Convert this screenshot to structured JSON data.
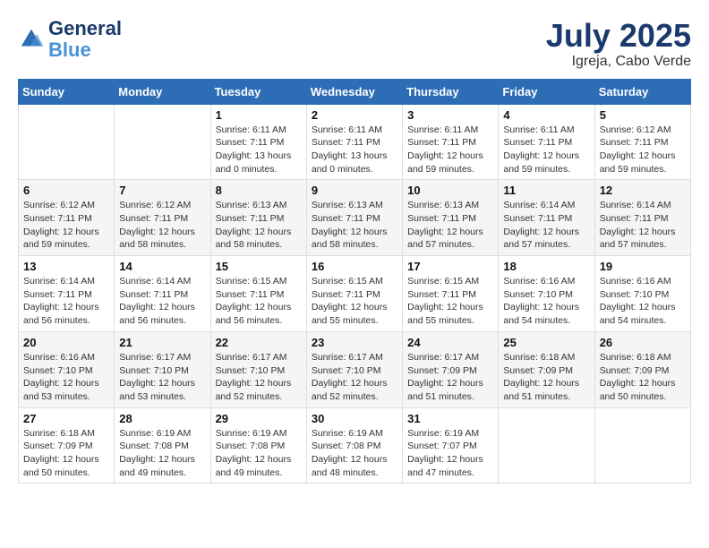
{
  "header": {
    "logo_line1": "General",
    "logo_line2": "Blue",
    "month": "July 2025",
    "location": "Igreja, Cabo Verde"
  },
  "days_of_week": [
    "Sunday",
    "Monday",
    "Tuesday",
    "Wednesday",
    "Thursday",
    "Friday",
    "Saturday"
  ],
  "weeks": [
    [
      {
        "day": "",
        "info": ""
      },
      {
        "day": "",
        "info": ""
      },
      {
        "day": "1",
        "info": "Sunrise: 6:11 AM\nSunset: 7:11 PM\nDaylight: 13 hours\nand 0 minutes."
      },
      {
        "day": "2",
        "info": "Sunrise: 6:11 AM\nSunset: 7:11 PM\nDaylight: 13 hours\nand 0 minutes."
      },
      {
        "day": "3",
        "info": "Sunrise: 6:11 AM\nSunset: 7:11 PM\nDaylight: 12 hours\nand 59 minutes."
      },
      {
        "day": "4",
        "info": "Sunrise: 6:11 AM\nSunset: 7:11 PM\nDaylight: 12 hours\nand 59 minutes."
      },
      {
        "day": "5",
        "info": "Sunrise: 6:12 AM\nSunset: 7:11 PM\nDaylight: 12 hours\nand 59 minutes."
      }
    ],
    [
      {
        "day": "6",
        "info": "Sunrise: 6:12 AM\nSunset: 7:11 PM\nDaylight: 12 hours\nand 59 minutes."
      },
      {
        "day": "7",
        "info": "Sunrise: 6:12 AM\nSunset: 7:11 PM\nDaylight: 12 hours\nand 58 minutes."
      },
      {
        "day": "8",
        "info": "Sunrise: 6:13 AM\nSunset: 7:11 PM\nDaylight: 12 hours\nand 58 minutes."
      },
      {
        "day": "9",
        "info": "Sunrise: 6:13 AM\nSunset: 7:11 PM\nDaylight: 12 hours\nand 58 minutes."
      },
      {
        "day": "10",
        "info": "Sunrise: 6:13 AM\nSunset: 7:11 PM\nDaylight: 12 hours\nand 57 minutes."
      },
      {
        "day": "11",
        "info": "Sunrise: 6:14 AM\nSunset: 7:11 PM\nDaylight: 12 hours\nand 57 minutes."
      },
      {
        "day": "12",
        "info": "Sunrise: 6:14 AM\nSunset: 7:11 PM\nDaylight: 12 hours\nand 57 minutes."
      }
    ],
    [
      {
        "day": "13",
        "info": "Sunrise: 6:14 AM\nSunset: 7:11 PM\nDaylight: 12 hours\nand 56 minutes."
      },
      {
        "day": "14",
        "info": "Sunrise: 6:14 AM\nSunset: 7:11 PM\nDaylight: 12 hours\nand 56 minutes."
      },
      {
        "day": "15",
        "info": "Sunrise: 6:15 AM\nSunset: 7:11 PM\nDaylight: 12 hours\nand 56 minutes."
      },
      {
        "day": "16",
        "info": "Sunrise: 6:15 AM\nSunset: 7:11 PM\nDaylight: 12 hours\nand 55 minutes."
      },
      {
        "day": "17",
        "info": "Sunrise: 6:15 AM\nSunset: 7:11 PM\nDaylight: 12 hours\nand 55 minutes."
      },
      {
        "day": "18",
        "info": "Sunrise: 6:16 AM\nSunset: 7:10 PM\nDaylight: 12 hours\nand 54 minutes."
      },
      {
        "day": "19",
        "info": "Sunrise: 6:16 AM\nSunset: 7:10 PM\nDaylight: 12 hours\nand 54 minutes."
      }
    ],
    [
      {
        "day": "20",
        "info": "Sunrise: 6:16 AM\nSunset: 7:10 PM\nDaylight: 12 hours\nand 53 minutes."
      },
      {
        "day": "21",
        "info": "Sunrise: 6:17 AM\nSunset: 7:10 PM\nDaylight: 12 hours\nand 53 minutes."
      },
      {
        "day": "22",
        "info": "Sunrise: 6:17 AM\nSunset: 7:10 PM\nDaylight: 12 hours\nand 52 minutes."
      },
      {
        "day": "23",
        "info": "Sunrise: 6:17 AM\nSunset: 7:10 PM\nDaylight: 12 hours\nand 52 minutes."
      },
      {
        "day": "24",
        "info": "Sunrise: 6:17 AM\nSunset: 7:09 PM\nDaylight: 12 hours\nand 51 minutes."
      },
      {
        "day": "25",
        "info": "Sunrise: 6:18 AM\nSunset: 7:09 PM\nDaylight: 12 hours\nand 51 minutes."
      },
      {
        "day": "26",
        "info": "Sunrise: 6:18 AM\nSunset: 7:09 PM\nDaylight: 12 hours\nand 50 minutes."
      }
    ],
    [
      {
        "day": "27",
        "info": "Sunrise: 6:18 AM\nSunset: 7:09 PM\nDaylight: 12 hours\nand 50 minutes."
      },
      {
        "day": "28",
        "info": "Sunrise: 6:19 AM\nSunset: 7:08 PM\nDaylight: 12 hours\nand 49 minutes."
      },
      {
        "day": "29",
        "info": "Sunrise: 6:19 AM\nSunset: 7:08 PM\nDaylight: 12 hours\nand 49 minutes."
      },
      {
        "day": "30",
        "info": "Sunrise: 6:19 AM\nSunset: 7:08 PM\nDaylight: 12 hours\nand 48 minutes."
      },
      {
        "day": "31",
        "info": "Sunrise: 6:19 AM\nSunset: 7:07 PM\nDaylight: 12 hours\nand 47 minutes."
      },
      {
        "day": "",
        "info": ""
      },
      {
        "day": "",
        "info": ""
      }
    ]
  ]
}
